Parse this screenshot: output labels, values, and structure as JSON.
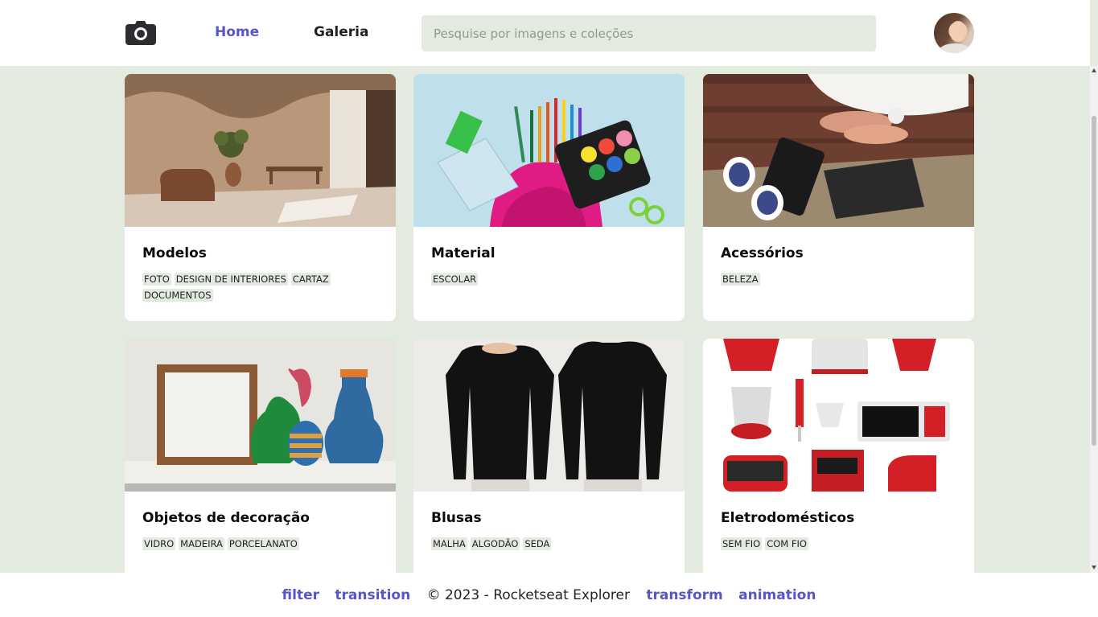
{
  "header": {
    "logo_icon": "camera-icon",
    "nav": [
      {
        "label": "Home",
        "active": true
      },
      {
        "label": "Galeria",
        "active": false
      }
    ],
    "search_placeholder": "Pesquise por imagens e coleções",
    "avatar_icon": "user-avatar"
  },
  "cards": [
    {
      "title": "Modelos",
      "tags": [
        "FOTO",
        "DESIGN DE INTERIORES",
        "CARTAZ",
        "DOCUMENTOS"
      ]
    },
    {
      "title": "Material",
      "tags": [
        "ESCOLAR"
      ]
    },
    {
      "title": "Acessórios",
      "tags": [
        "BELEZA"
      ]
    },
    {
      "title": "Objetos de decoração",
      "tags": [
        "VIDRO",
        "MADEIRA",
        "PORCELANATO"
      ]
    },
    {
      "title": "Blusas",
      "tags": [
        "MALHA",
        "ALGODÃO",
        "SEDA"
      ]
    },
    {
      "title": "Eletrodomésticos",
      "tags": [
        "SEM FIO",
        "COM FIO"
      ]
    }
  ],
  "footer": {
    "links_left": [
      "filter",
      "transition"
    ],
    "copyright": "© 2023 - Rocketseat Explorer",
    "links_right": [
      "transform",
      "animation"
    ]
  },
  "colors": {
    "accent": "#5a55c6",
    "background": "#e3ebe0",
    "card": "#ffffff",
    "text": "#1f2123"
  }
}
